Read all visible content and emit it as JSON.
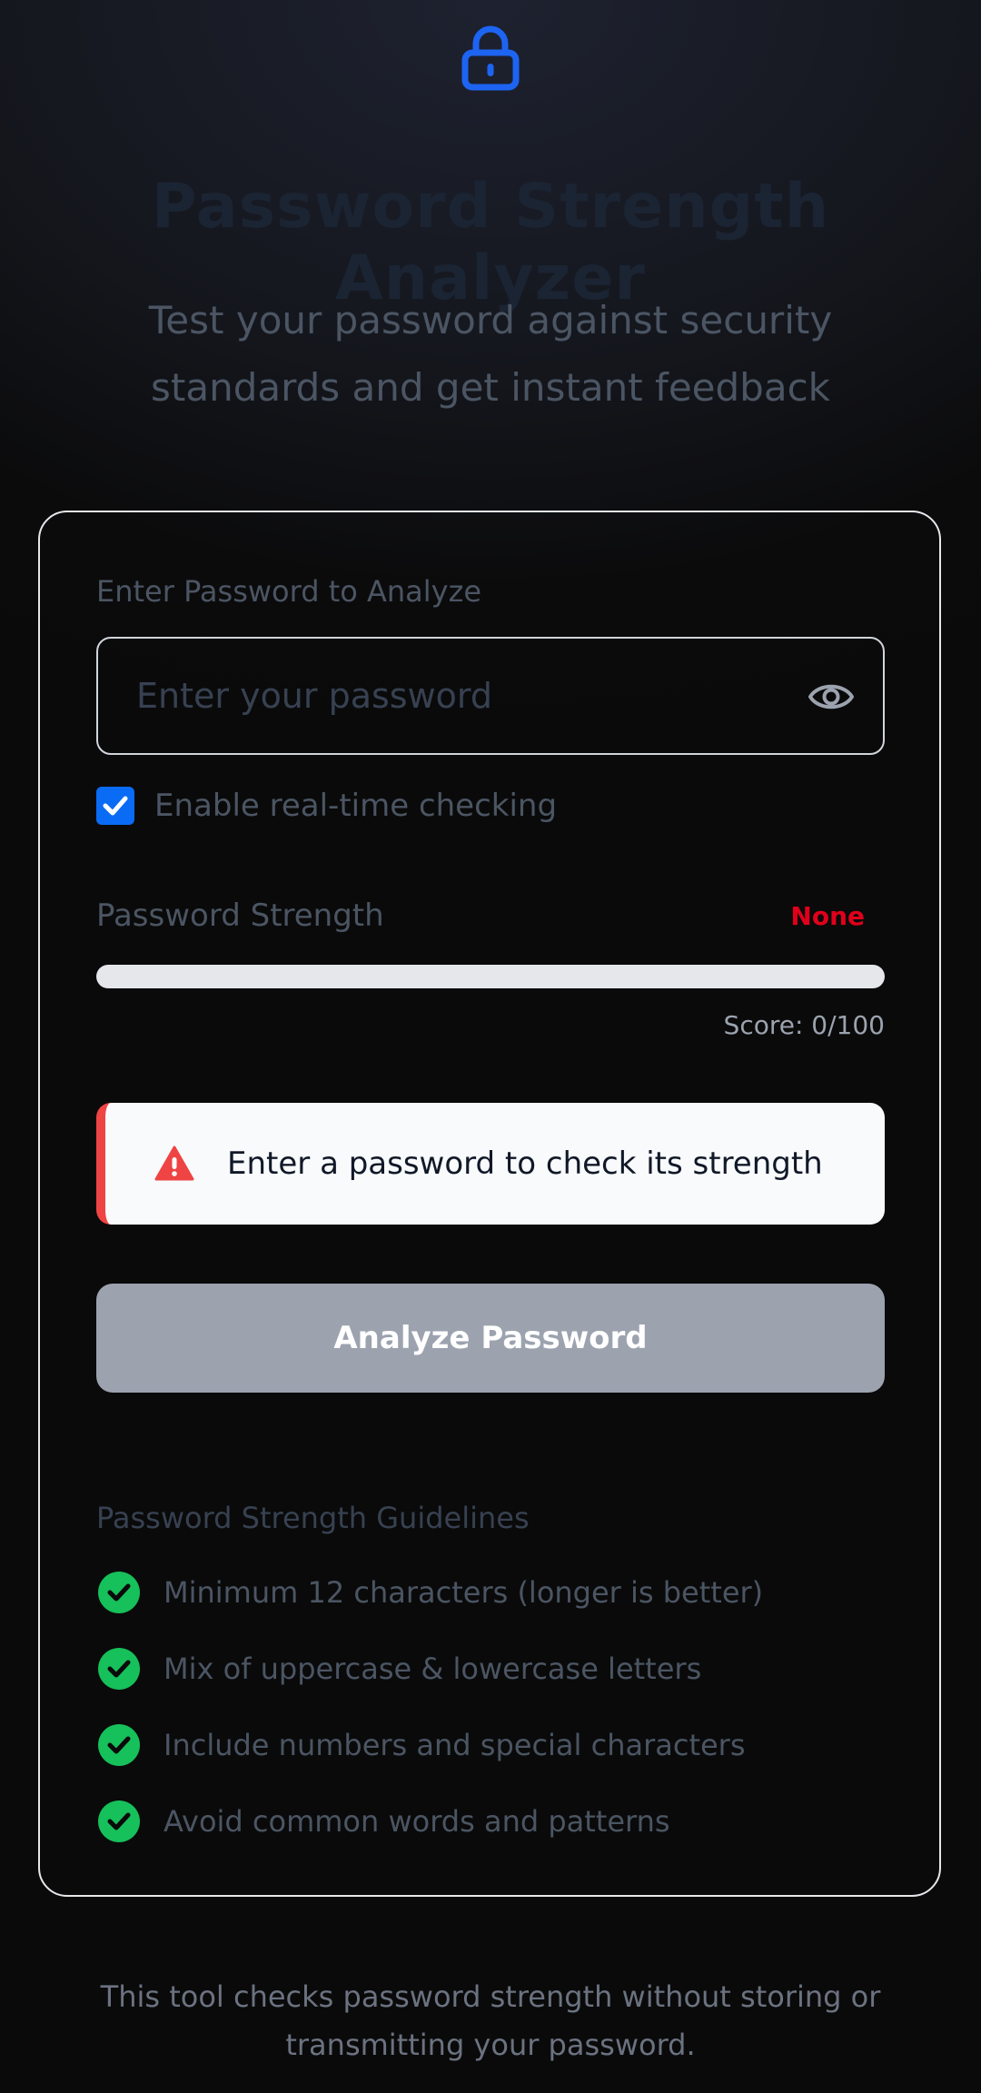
{
  "header": {
    "icon": "lock-icon",
    "title": "Password Strength Analyzer",
    "subtitle": "Test your password against security standards and get instant feedback"
  },
  "form": {
    "label": "Enter Password to Analyze",
    "placeholder": "Enter your password",
    "value": "",
    "visibility_icon": "eye-icon",
    "realtime_checked": true,
    "realtime_label": "Enable real-time checking"
  },
  "strength": {
    "label": "Password Strength",
    "value": "None",
    "value_color": "#e0001b",
    "score_text": "Score: 0/100",
    "score": 0
  },
  "alert": {
    "icon": "warning-icon",
    "message": "Enter a password to check its strength"
  },
  "analyze_button": {
    "label": "Analyze Password"
  },
  "guidelines": {
    "title": "Password Strength Guidelines",
    "items": [
      {
        "icon": "check-circle-icon",
        "text": "Minimum 12 characters (longer is better)"
      },
      {
        "icon": "check-circle-icon",
        "text": "Mix of uppercase & lowercase letters"
      },
      {
        "icon": "check-circle-icon",
        "text": "Include numbers and special characters"
      },
      {
        "icon": "check-circle-icon",
        "text": "Avoid common words and patterns"
      }
    ]
  },
  "footer": {
    "text": "This tool checks password strength without storing or transmitting your password."
  },
  "colors": {
    "accent": "#0a6cf5",
    "danger": "#ef4444",
    "success": "#16c05a",
    "button_disabled": "#9ca3af"
  }
}
